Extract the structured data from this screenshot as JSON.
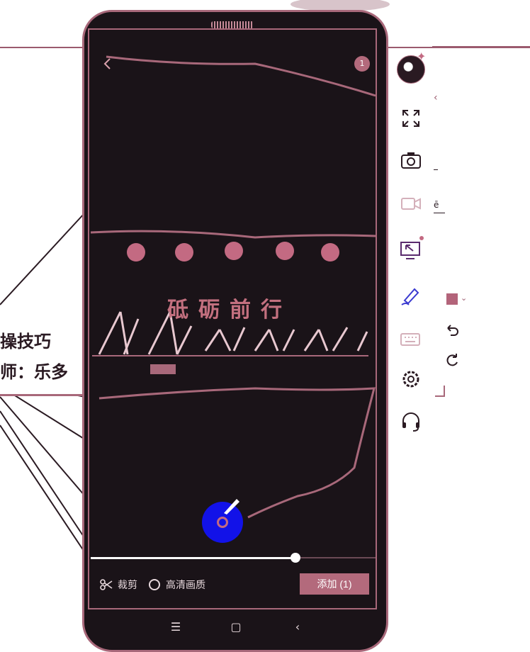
{
  "background_slide": {
    "title_fragment": "操技巧",
    "subtitle_fragment": "师：乐多"
  },
  "screen": {
    "back_icon": "chevron-left-icon",
    "selected_count": "1",
    "banner_text": "砥砺前行"
  },
  "video_progress": 0.72,
  "bottom_bar": {
    "crop_label": "裁剪",
    "crop_icon": "scissors-icon",
    "hd_label": "高清画质",
    "add_label": "添加 (1)"
  },
  "nav_bar": {
    "menu_icon": "☰",
    "home_icon": "▢",
    "back_icon": "‹"
  },
  "toolbar": {
    "collapse_icon": "‹",
    "tiny_mark": "ē",
    "items": [
      {
        "name": "fullscreen-icon"
      },
      {
        "name": "camera-icon"
      },
      {
        "name": "video-camera-icon"
      },
      {
        "name": "screen-share-icon"
      },
      {
        "name": "pen-icon"
      },
      {
        "name": "keyboard-icon"
      },
      {
        "name": "settings-icon"
      },
      {
        "name": "headset-icon"
      }
    ]
  },
  "colors": {
    "accent": "#b36a7c",
    "screen_bg": "#1a1318",
    "blue_pointer": "#1212e8",
    "pen_color": "#b3647a"
  }
}
